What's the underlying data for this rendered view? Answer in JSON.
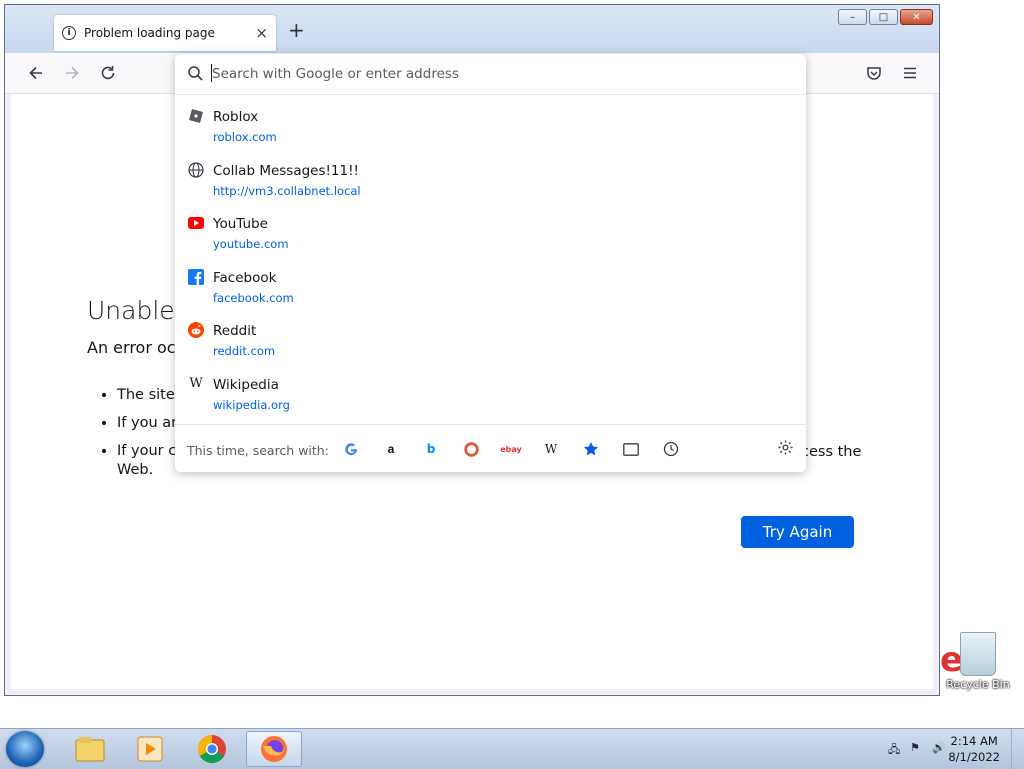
{
  "browser": {
    "tab": {
      "title": "Problem loading page",
      "close_glyph": "×"
    },
    "new_tab_glyph": "+",
    "caption": {
      "minimize": "–",
      "maximize": "□",
      "close": "✕"
    }
  },
  "urlbar": {
    "placeholder": "Search with Google or enter address",
    "suggestions": [
      {
        "name": "Roblox",
        "url": "roblox.com",
        "icon": "roblox-icon"
      },
      {
        "name": "Collab Messages!11!!",
        "url": "http://vm3.collabnet.local",
        "icon": "globe-icon"
      },
      {
        "name": "YouTube",
        "url": "youtube.com",
        "icon": "youtube-icon"
      },
      {
        "name": "Facebook",
        "url": "facebook.com",
        "icon": "facebook-icon"
      },
      {
        "name": "Reddit",
        "url": "reddit.com",
        "icon": "reddit-icon"
      },
      {
        "name": "Wikipedia",
        "url": "wikipedia.org",
        "icon": "wikipedia-icon"
      }
    ],
    "search_with_label": "This time, search with:",
    "engines": [
      "google",
      "amazon",
      "bing",
      "duckduckgo",
      "ebay",
      "wikipedia",
      "bookmarks",
      "tabs",
      "history"
    ]
  },
  "error_page": {
    "title": "Unable",
    "subtitle": "An error oc",
    "bullets": [
      "The site",
      "If you are",
      "If your co"
    ],
    "trailing_text": "cess the",
    "web_text": "Web.",
    "button": "Try Again"
  },
  "desktop": {
    "recycle_bin_label": "Recycle Bin"
  },
  "taskbar": {
    "time": "2:14 AM",
    "date": "8/1/2022"
  },
  "colors": {
    "accent": "#0061e0",
    "link": "#0060df",
    "taskbar": "#c3d3e6"
  }
}
